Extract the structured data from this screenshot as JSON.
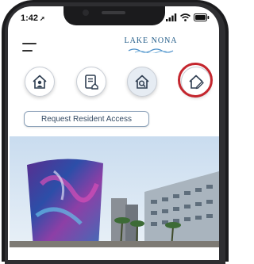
{
  "status_bar": {
    "time": "1:42",
    "location_arrow": "location-arrow-icon",
    "signal_icon": "cellular-signal-icon",
    "wifi_icon": "wifi-icon",
    "battery_icon": "battery-icon"
  },
  "header": {
    "menu_icon": "hamburger-menu-icon",
    "logo_text": "LAKE NONA"
  },
  "icon_row": [
    {
      "icon": "home-person-icon",
      "selected": false
    },
    {
      "icon": "document-house-icon",
      "selected": false
    },
    {
      "icon": "home-search-icon",
      "selected": true
    },
    {
      "icon": "home-edit-icon",
      "selected": false,
      "highlighted": true
    }
  ],
  "actions": {
    "request_label": "Request Resident Access"
  },
  "hero": {
    "image": "lake-nona-town-center-photo"
  },
  "colors": {
    "highlight_ring": "#c4262e",
    "icon_stroke": "#2f3e51",
    "logo": "#1f5a87"
  }
}
